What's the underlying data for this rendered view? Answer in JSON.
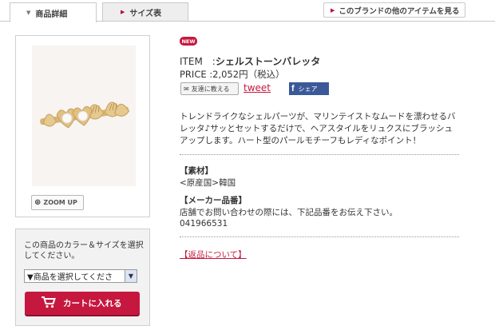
{
  "tabs": [
    {
      "label": "商品詳細",
      "active": true
    },
    {
      "label": "サイズ表",
      "active": false
    }
  ],
  "brand_link": "このブランドの他のアイテムを見る",
  "zoom_label": "ZOOM UP",
  "cart": {
    "message": "この商品のカラー＆サイズを選択してください。",
    "select_value": "▼商品を選択してくださ",
    "button_label": "カートに入れる"
  },
  "badge": "NEW",
  "item": {
    "item_prefix": "ITEM　:",
    "name": "シェルストーンバレッタ",
    "price_line": "PRICE :2,052円（税込）"
  },
  "share": {
    "tell_friend": "友達に教える",
    "tweet": "tweet",
    "facebook": "シェア"
  },
  "description": "トレンドライクなシェルパーツが、マリンテイストなムードを漂わせるバレッタ♪サッとセットするだけで、ヘアスタイルをリュクスにブラッシュアップします。ハート型のパールモチーフもレディなポイント！",
  "material": {
    "heading": "【素材】",
    "origin": "<原産国>韓国"
  },
  "maker": {
    "heading": "【メーカー品番】",
    "note": "店舗でお問い合わせの際には、下記品番をお伝え下さい。",
    "code": "041966531"
  },
  "returns_link": "【返品について】",
  "colors": {
    "accent": "#c6183f",
    "facebook": "#3b5998"
  }
}
